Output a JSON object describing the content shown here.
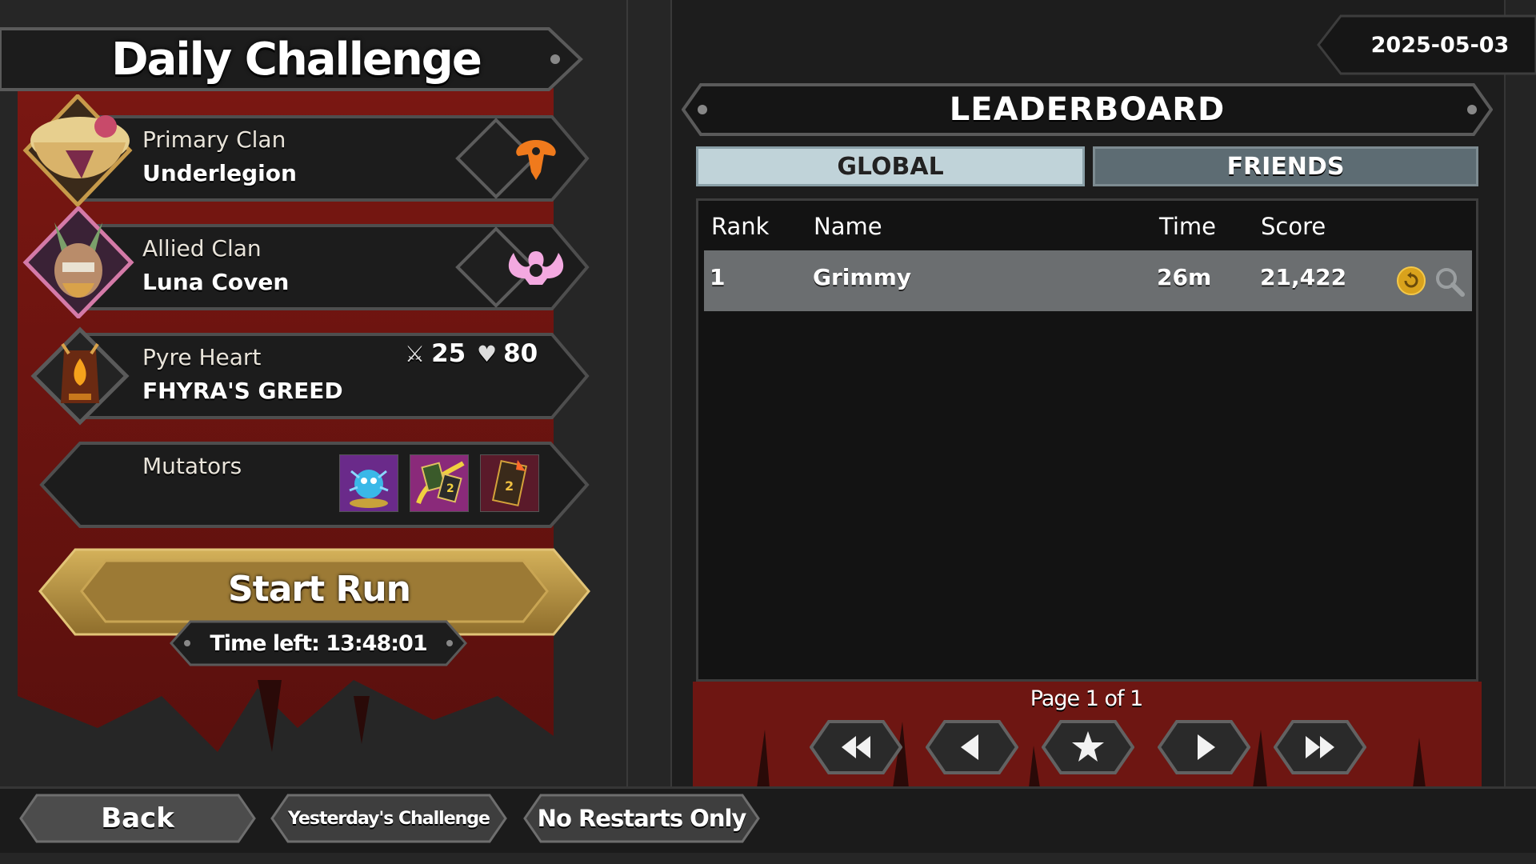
{
  "title": "Daily Challenge",
  "date": "2025-05-03",
  "primary_clan": {
    "label": "Primary Clan",
    "name": "Underlegion"
  },
  "allied_clan": {
    "label": "Allied Clan",
    "name": "Luna Coven"
  },
  "pyre_heart": {
    "label": "Pyre Heart",
    "name": "FHYRA'S GREED",
    "attack": "25",
    "health": "80"
  },
  "mutators": {
    "label": "Mutators",
    "icons": [
      "mutator-blue-creature-icon",
      "mutator-cards-icon",
      "mutator-card-burn-icon"
    ]
  },
  "start_run": {
    "label": "Start Run",
    "time_left": "Time left: 13:48:01"
  },
  "leaderboard": {
    "title": "LEADERBOARD",
    "tabs": [
      "GLOBAL",
      "FRIENDS"
    ],
    "active_tab": "GLOBAL",
    "columns": [
      "Rank",
      "Name",
      "Time",
      "Score"
    ],
    "rows": [
      {
        "rank": "1",
        "name": "Grimmy",
        "time": "26m",
        "score": "21,422"
      }
    ],
    "page": "Page 1 of 1"
  },
  "bottom": {
    "back": "Back",
    "yesterday": "Yesterday's Challenge",
    "no_restarts": "No Restarts Only"
  },
  "colors": {
    "banner_red": "#6e1612",
    "gold": "#b38f3c",
    "panel_dark": "#1a1a1a",
    "tab_active": "#c0d3d9",
    "tab_inactive": "#5d6c73",
    "row_highlight": "#6b6e70"
  }
}
